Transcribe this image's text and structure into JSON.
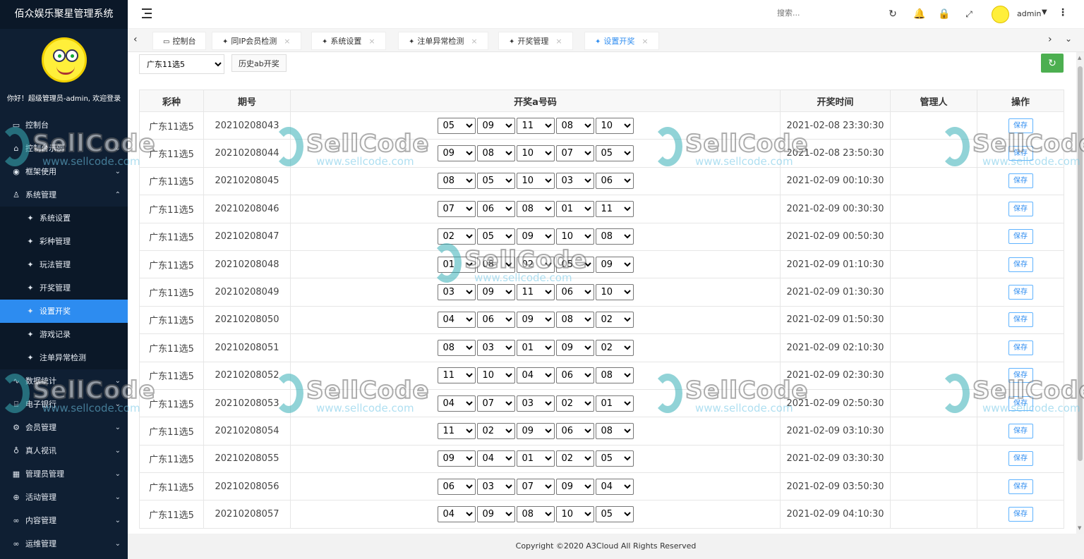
{
  "app": {
    "title": "佰众娱乐聚星管理系统",
    "welcome": "你好！超级管理员-admin, 欢迎登录"
  },
  "sidebar": {
    "items": [
      {
        "label": "控制台",
        "icon": "monitor-icon",
        "glyph": "▭",
        "chev": "",
        "sub": false,
        "active": false
      },
      {
        "label": "控制台示例",
        "icon": "home-icon",
        "glyph": "⌂",
        "chev": "⌄",
        "sub": false,
        "active": false
      },
      {
        "label": "框架使用",
        "icon": "badge-icon",
        "glyph": "◉",
        "chev": "⌄",
        "sub": false,
        "active": false
      },
      {
        "label": "系统管理",
        "icon": "user-icon",
        "glyph": "♙",
        "chev": "⌃",
        "sub": false,
        "active": false
      },
      {
        "label": "系统设置",
        "icon": "pin-icon",
        "glyph": "✦",
        "chev": "",
        "sub": true,
        "active": false
      },
      {
        "label": "彩种管理",
        "icon": "pin-icon",
        "glyph": "✦",
        "chev": "",
        "sub": true,
        "active": false
      },
      {
        "label": "玩法管理",
        "icon": "pin-icon",
        "glyph": "✦",
        "chev": "",
        "sub": true,
        "active": false
      },
      {
        "label": "开奖管理",
        "icon": "pin-icon",
        "glyph": "✦",
        "chev": "",
        "sub": true,
        "active": false
      },
      {
        "label": "设置开奖",
        "icon": "pin-icon",
        "glyph": "✦",
        "chev": "",
        "sub": true,
        "active": true
      },
      {
        "label": "游戏记录",
        "icon": "pin-icon",
        "glyph": "✦",
        "chev": "",
        "sub": true,
        "active": false
      },
      {
        "label": "注单异常检测",
        "icon": "pin-icon",
        "glyph": "✦",
        "chev": "",
        "sub": true,
        "active": false
      },
      {
        "label": "数据统计",
        "icon": "chart-icon",
        "glyph": "∿",
        "chev": "⌄",
        "sub": false,
        "active": false
      },
      {
        "label": "电子银行",
        "icon": "bank-icon",
        "glyph": "⌸",
        "chev": "⌄",
        "sub": false,
        "active": false
      },
      {
        "label": "会员管理",
        "icon": "gear-icon",
        "glyph": "⚙",
        "chev": "⌄",
        "sub": false,
        "active": false
      },
      {
        "label": "真人视讯",
        "icon": "flask-icon",
        "glyph": "♁",
        "chev": "⌄",
        "sub": false,
        "active": false
      },
      {
        "label": "管理员管理",
        "icon": "grid-icon",
        "glyph": "▦",
        "chev": "⌄",
        "sub": false,
        "active": false
      },
      {
        "label": "活动管理",
        "icon": "plus-circle-icon",
        "glyph": "⊕",
        "chev": "⌄",
        "sub": false,
        "active": false
      },
      {
        "label": "内容管理",
        "icon": "link-icon",
        "glyph": "∞",
        "chev": "⌄",
        "sub": false,
        "active": false
      },
      {
        "label": "运维管理",
        "icon": "link-icon",
        "glyph": "∞",
        "chev": "⌄",
        "sub": false,
        "active": false
      }
    ]
  },
  "header": {
    "search_placeholder": "搜索...",
    "user": "admin"
  },
  "tabs": [
    {
      "label": "控制台",
      "closable": false,
      "active": false
    },
    {
      "label": "同IP会员检测",
      "closable": true,
      "active": false
    },
    {
      "label": "系统设置",
      "closable": true,
      "active": false
    },
    {
      "label": "注单异常检测",
      "closable": true,
      "active": false
    },
    {
      "label": "开奖管理",
      "closable": true,
      "active": false
    },
    {
      "label": "设置开奖",
      "closable": true,
      "active": true
    }
  ],
  "toolbar": {
    "lottery_selected": "广东11选5",
    "history_button": "历史ab开奖"
  },
  "table": {
    "headers": [
      "彩种",
      "期号",
      "开奖a号码",
      "开奖时间",
      "管理人",
      "操作"
    ],
    "save_label": "保存",
    "rows": [
      {
        "lottery": "广东11选5",
        "issue": "20210208043",
        "nums": [
          "05",
          "09",
          "11",
          "08",
          "10"
        ],
        "time": "2021-02-08 23:30:30",
        "admin": ""
      },
      {
        "lottery": "广东11选5",
        "issue": "20210208044",
        "nums": [
          "09",
          "08",
          "10",
          "07",
          "05"
        ],
        "time": "2021-02-08 23:50:30",
        "admin": ""
      },
      {
        "lottery": "广东11选5",
        "issue": "20210208045",
        "nums": [
          "08",
          "05",
          "10",
          "03",
          "06"
        ],
        "time": "2021-02-09 00:10:30",
        "admin": ""
      },
      {
        "lottery": "广东11选5",
        "issue": "20210208046",
        "nums": [
          "07",
          "06",
          "08",
          "01",
          "11"
        ],
        "time": "2021-02-09 00:30:30",
        "admin": ""
      },
      {
        "lottery": "广东11选5",
        "issue": "20210208047",
        "nums": [
          "02",
          "05",
          "09",
          "10",
          "08"
        ],
        "time": "2021-02-09 00:50:30",
        "admin": ""
      },
      {
        "lottery": "广东11选5",
        "issue": "20210208048",
        "nums": [
          "01",
          "08",
          "02",
          "05",
          "09"
        ],
        "time": "2021-02-09 01:10:30",
        "admin": ""
      },
      {
        "lottery": "广东11选5",
        "issue": "20210208049",
        "nums": [
          "03",
          "09",
          "11",
          "06",
          "10"
        ],
        "time": "2021-02-09 01:30:30",
        "admin": ""
      },
      {
        "lottery": "广东11选5",
        "issue": "20210208050",
        "nums": [
          "04",
          "06",
          "09",
          "08",
          "02"
        ],
        "time": "2021-02-09 01:50:30",
        "admin": ""
      },
      {
        "lottery": "广东11选5",
        "issue": "20210208051",
        "nums": [
          "08",
          "03",
          "01",
          "09",
          "02"
        ],
        "time": "2021-02-09 02:10:30",
        "admin": ""
      },
      {
        "lottery": "广东11选5",
        "issue": "20210208052",
        "nums": [
          "11",
          "10",
          "04",
          "06",
          "08"
        ],
        "time": "2021-02-09 02:30:30",
        "admin": ""
      },
      {
        "lottery": "广东11选5",
        "issue": "20210208053",
        "nums": [
          "04",
          "07",
          "03",
          "02",
          "01"
        ],
        "time": "2021-02-09 02:50:30",
        "admin": ""
      },
      {
        "lottery": "广东11选5",
        "issue": "20210208054",
        "nums": [
          "11",
          "02",
          "09",
          "06",
          "08"
        ],
        "time": "2021-02-09 03:10:30",
        "admin": ""
      },
      {
        "lottery": "广东11选5",
        "issue": "20210208055",
        "nums": [
          "09",
          "04",
          "01",
          "02",
          "05"
        ],
        "time": "2021-02-09 03:30:30",
        "admin": ""
      },
      {
        "lottery": "广东11选5",
        "issue": "20210208056",
        "nums": [
          "06",
          "03",
          "07",
          "09",
          "04"
        ],
        "time": "2021-02-09 03:50:30",
        "admin": ""
      },
      {
        "lottery": "广东11选5",
        "issue": "20210208057",
        "nums": [
          "04",
          "09",
          "08",
          "10",
          "05"
        ],
        "time": "2021-02-09 04:10:30",
        "admin": ""
      }
    ]
  },
  "footer": {
    "copyright": "Copyright ©2020 A3Cloud All Rights Reserved"
  },
  "watermark": {
    "brand": "SellCode",
    "url": "www.sellcode.com"
  },
  "colors": {
    "sidebar_bg": "#0f1f33",
    "active": "#2d8cf0",
    "refresh": "#4caf50"
  }
}
